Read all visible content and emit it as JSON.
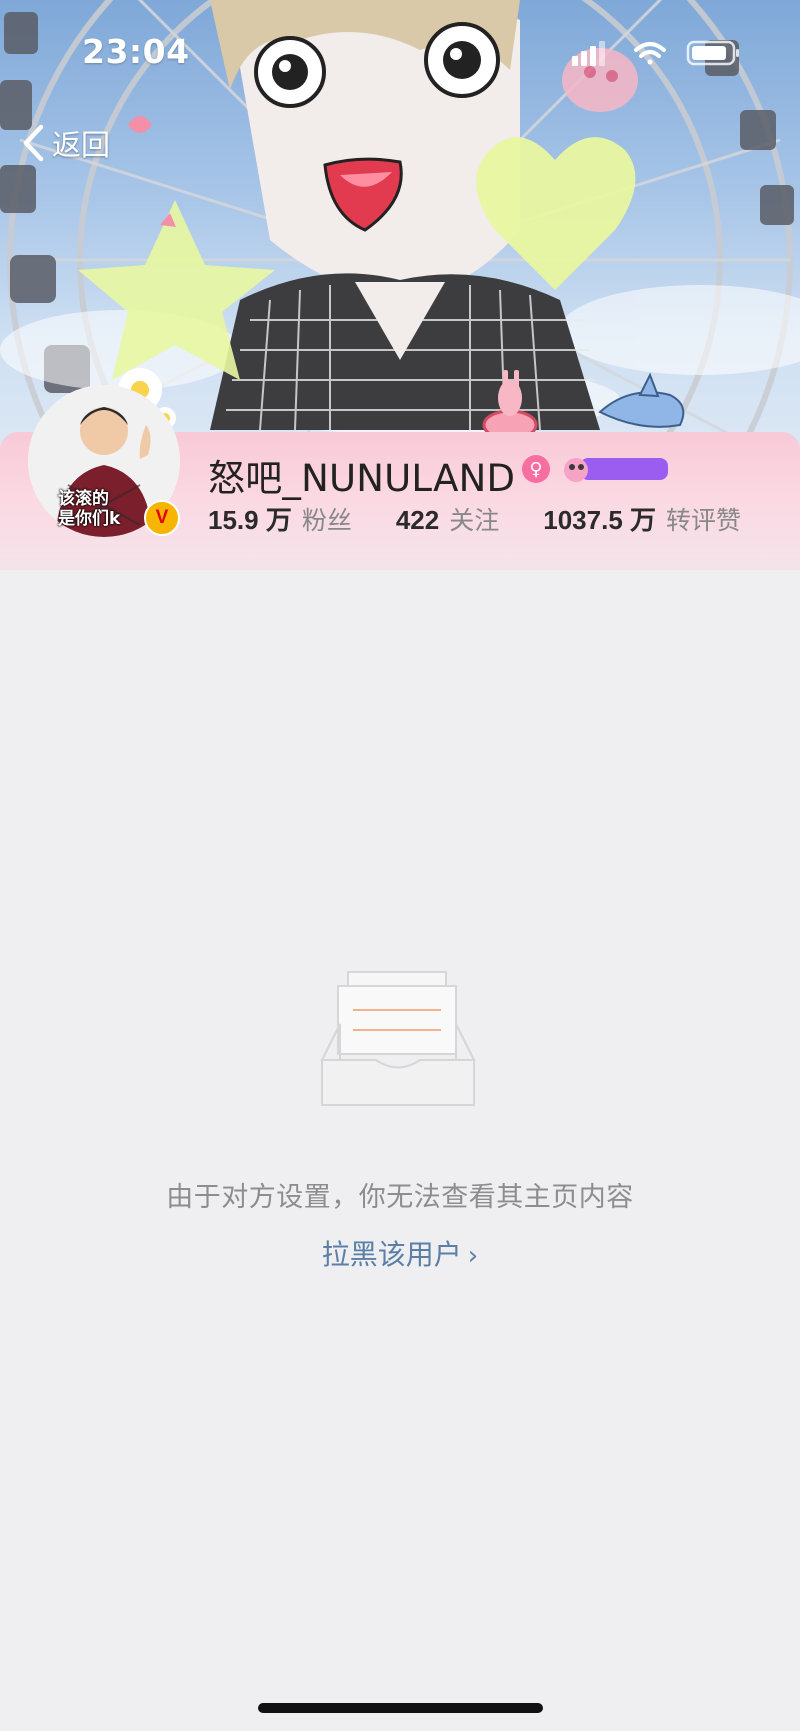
{
  "status_bar": {
    "time": "23:04"
  },
  "nav": {
    "back_label": "返回"
  },
  "profile": {
    "avatar_caption": "该滚的\n是你们k",
    "verified_badge": "V",
    "username": "怒吧_NUNULAND",
    "gender": "♀",
    "stats": [
      {
        "value": "15.9 万",
        "label": "粉丝"
      },
      {
        "value": "422",
        "label": "关注"
      },
      {
        "value": "1037.5 万",
        "label": "转评赞"
      }
    ]
  },
  "empty_state": {
    "message": "由于对方设置，你无法查看其主页内容",
    "block_link_label": "拉黑该用户",
    "block_link_chevron": "›"
  },
  "icons": {
    "back": "chevron-left-icon",
    "signal": "signal-icon",
    "wifi": "wifi-icon",
    "battery": "battery-icon",
    "empty": "empty-inbox-icon"
  },
  "colors": {
    "background": "#efeff1",
    "profile_band": "#fbd9e3",
    "link": "#5b7fa6",
    "muted_text": "#8d8d8d",
    "verified": "#f7b500"
  }
}
